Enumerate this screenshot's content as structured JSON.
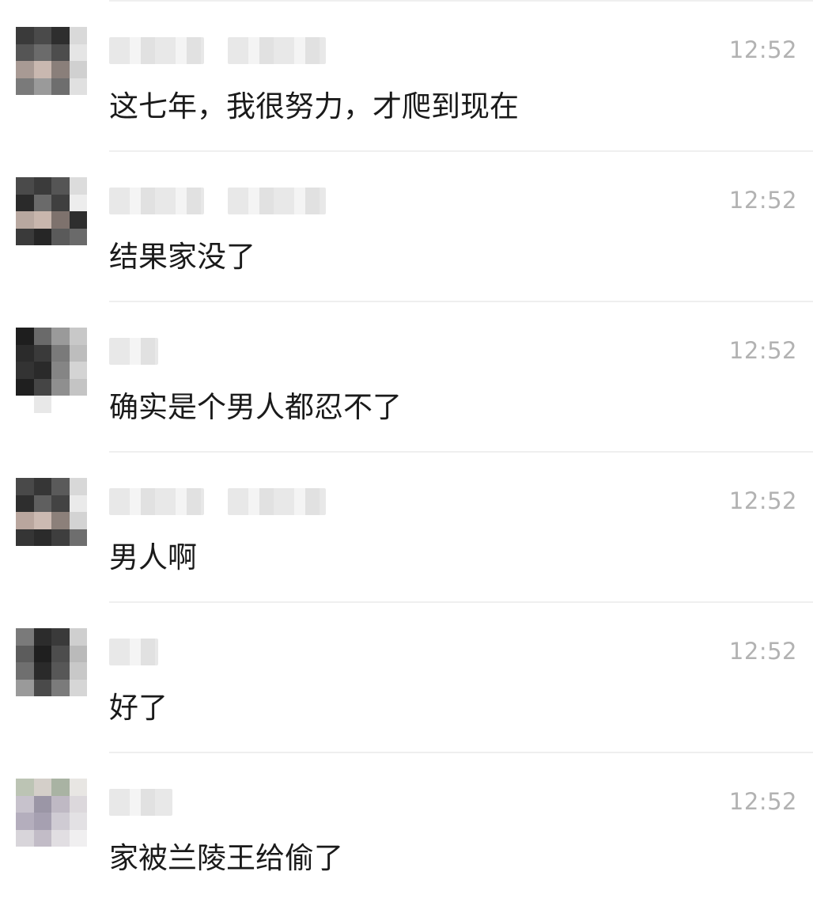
{
  "messages": [
    {
      "time": "12:52",
      "text": "这七年，我很努力，才爬到现在",
      "avatar_colors": [
        "#3a3a3a",
        "#4a4a4a",
        "#2e2e2e",
        "#d9d9d9",
        "#555",
        "#6b6b6b",
        "#4d4d4d",
        "#e5e5e5",
        "#a89a94",
        "#c9b8b0",
        "#8a7f7a",
        "#d0d0d0",
        "#7a7a7a",
        "#9a9a9a",
        "#6e6e6e",
        "#e0e0e0",
        "#ffffff",
        "#ffffff",
        "#ffffff",
        "#ffffff"
      ]
    },
    {
      "time": "12:52",
      "text": "结果家没了",
      "avatar_colors": [
        "#4a4a4a",
        "#3b3b3b",
        "#555",
        "#dcdcdc",
        "#2a2a2a",
        "#6a6a6a",
        "#3f3f3f",
        "#ededed",
        "#b8a8a0",
        "#c8b6ad",
        "#7e726d",
        "#2e2e2e",
        "#3a3a3a",
        "#262626",
        "#5a5a5a",
        "#6a6a6a",
        "#ffffff",
        "#ffffff",
        "#ffffff",
        "#ffffff"
      ]
    },
    {
      "time": "12:52",
      "text": "确实是个男人都忍不了",
      "avatar_colors": [
        "#1e1e1e",
        "#6a6a6a",
        "#9a9a9a",
        "#c8c8c8",
        "#2b2b2b",
        "#3a3a3a",
        "#7a7a7a",
        "#bdbdbd",
        "#333333",
        "#2a2a2a",
        "#858585",
        "#d4d4d4",
        "#1f1f1f",
        "#454545",
        "#8f8f8f",
        "#c4c4c4",
        "#ffffff",
        "#e8e8e8",
        "#ffffff",
        "#ffffff"
      ]
    },
    {
      "time": "12:52",
      "text": "男人啊",
      "avatar_colors": [
        "#494949",
        "#363636",
        "#5a5a5a",
        "#d8d8d8",
        "#2e2e2e",
        "#5f5f5f",
        "#434343",
        "#eaeaea",
        "#b9a69e",
        "#ccbab2",
        "#8c807a",
        "#d3d3d3",
        "#353535",
        "#2b2b2b",
        "#3e3e3e",
        "#6e6e6e",
        "#ffffff",
        "#ffffff",
        "#ffffff",
        "#ffffff"
      ]
    },
    {
      "time": "12:52",
      "text": "好了",
      "avatar_colors": [
        "#7a7a7a",
        "#2c2c2c",
        "#3a3a3a",
        "#cfcfcf",
        "#5c5c5c",
        "#1f1f1f",
        "#4d4d4d",
        "#bababa",
        "#6f6f6f",
        "#2a2a2a",
        "#575757",
        "#c8c8c8",
        "#9a9a9a",
        "#4a4a4a",
        "#7b7b7b",
        "#d6d6d6",
        "#ffffff",
        "#ffffff",
        "#ffffff",
        "#ffffff"
      ]
    },
    {
      "time": "12:52",
      "text": "家被兰陵王给偷了",
      "avatar_colors": [
        "#bcc4b4",
        "#d4cfc9",
        "#a9b3a3",
        "#e8e6e3",
        "#c7c2cc",
        "#9b96a6",
        "#bfb9c4",
        "#dcd8dc",
        "#b4aebd",
        "#a6a0b1",
        "#cfcbd3",
        "#e3e1e4",
        "#d8d5da",
        "#c2bcc7",
        "#e1dee2",
        "#f0eff0",
        "#ffffff",
        "#ffffff",
        "#ffffff",
        "#ffffff"
      ]
    }
  ]
}
